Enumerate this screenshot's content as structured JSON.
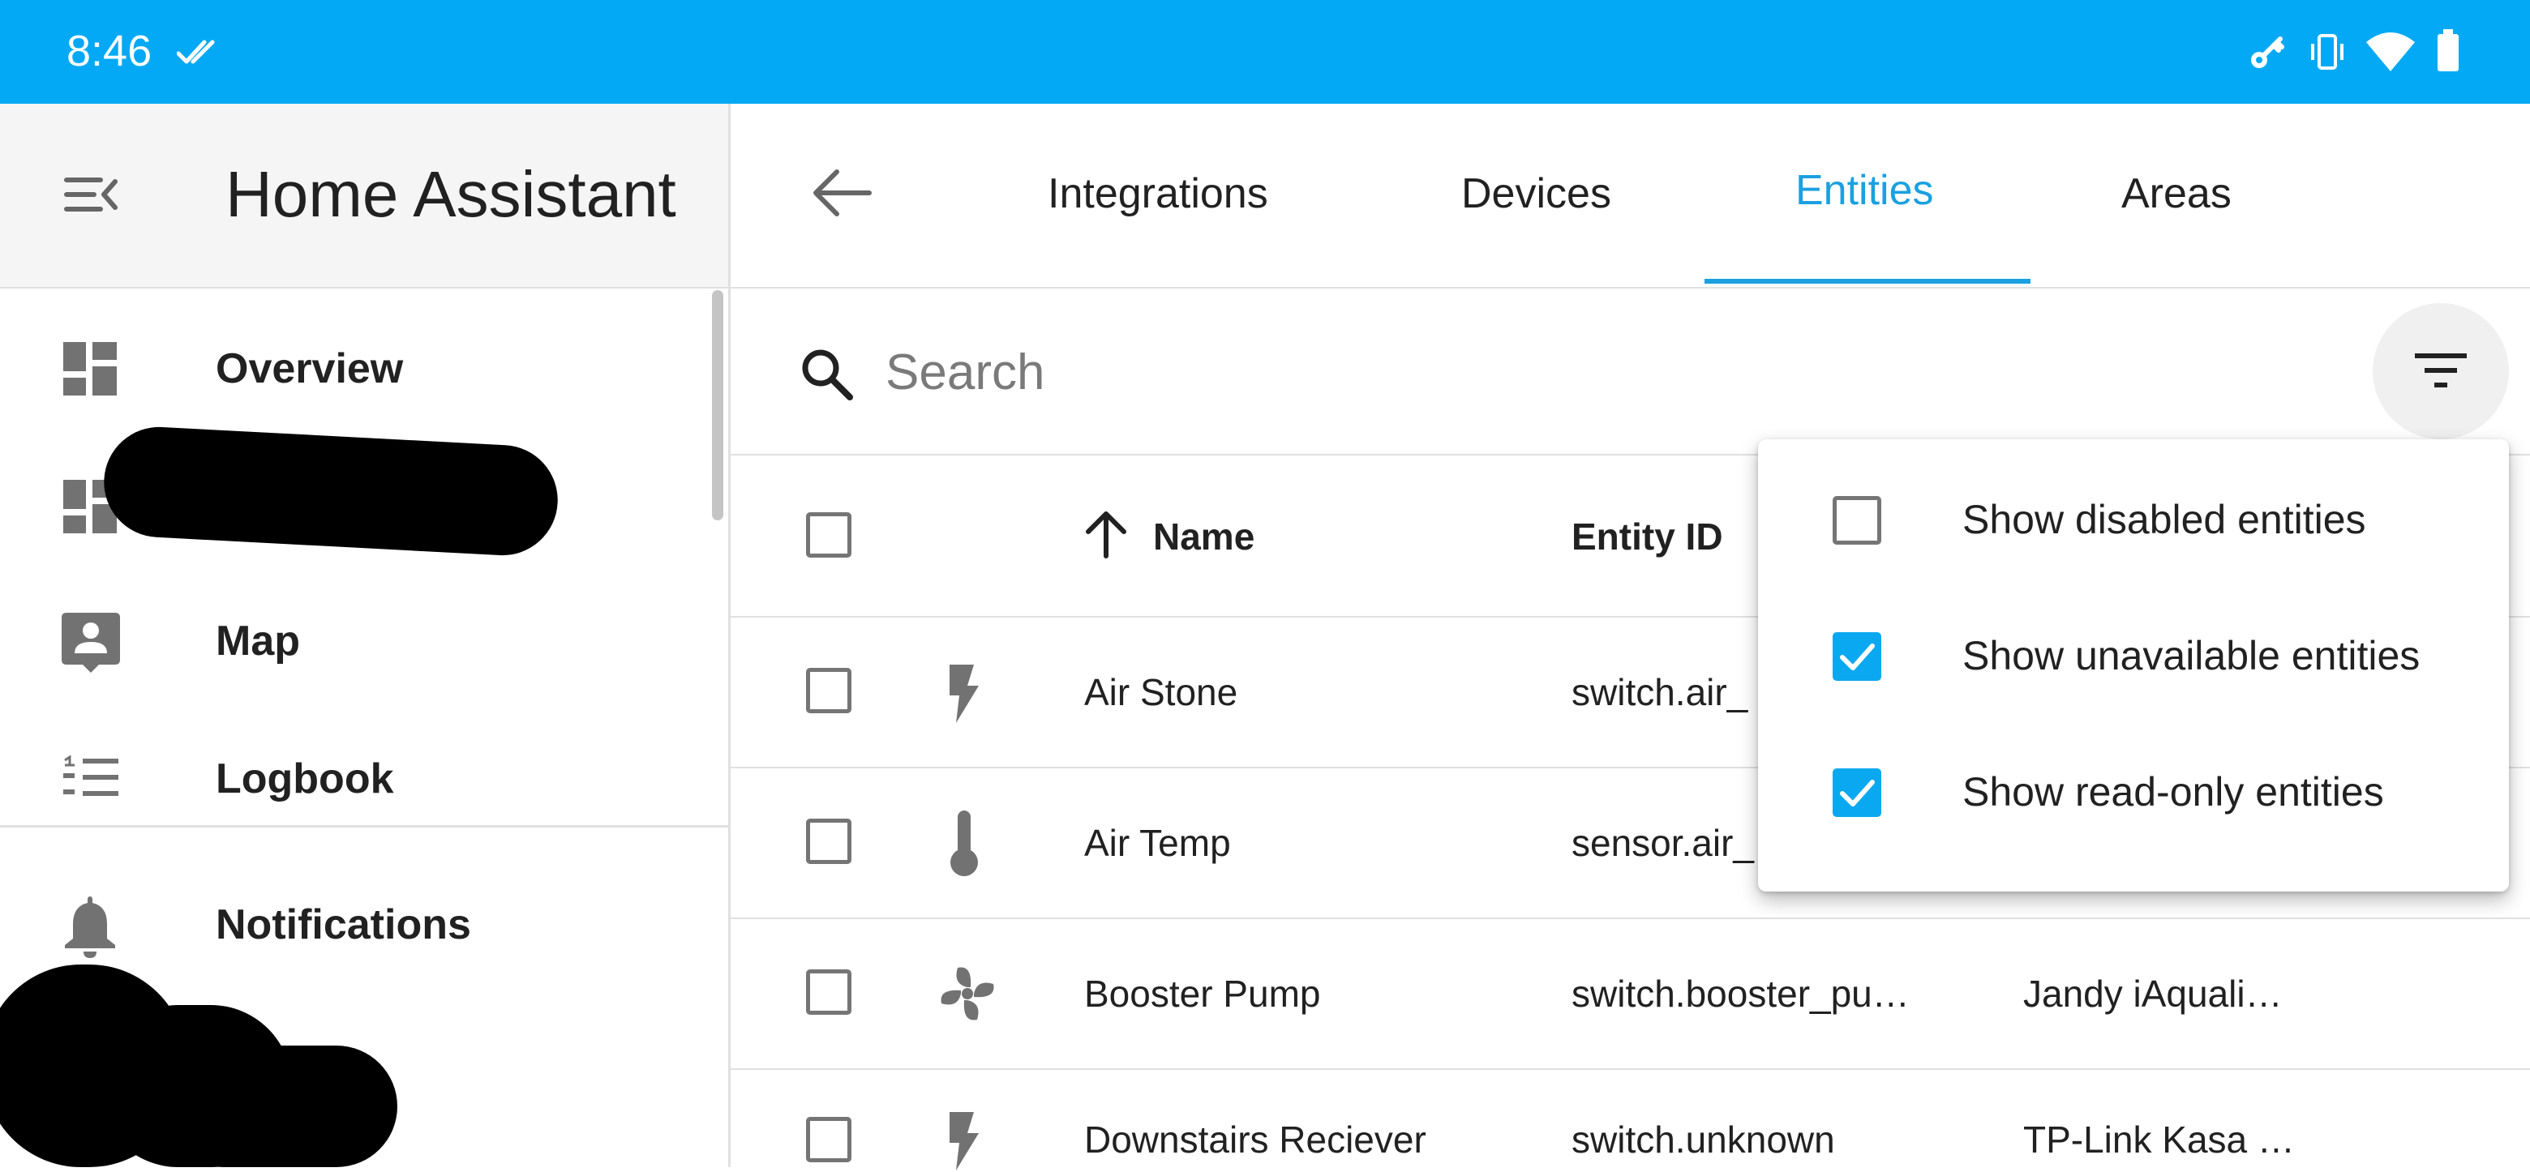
{
  "status_bar": {
    "time": "8:46",
    "icons": [
      "double-check-icon",
      "key-icon",
      "vibrate-icon",
      "wifi-icon",
      "battery-icon"
    ]
  },
  "sidebar": {
    "menu_icon": "menu-collapse-icon",
    "title": "Home Assistant",
    "items": [
      {
        "label": "Overview",
        "icon": "dashboard-icon"
      },
      {
        "label": "",
        "icon": "dashboard-icon"
      },
      {
        "label": "Map",
        "icon": "account-box-icon"
      },
      {
        "label": "Logbook",
        "icon": "list-icon"
      },
      {
        "label": "Notifications",
        "icon": "bell-icon"
      }
    ]
  },
  "tabs": {
    "back_icon": "arrow-left-icon",
    "items": [
      "Integrations",
      "Devices",
      "Entities",
      "Areas"
    ],
    "active": "Entities",
    "accent": "#03a9f4"
  },
  "search": {
    "placeholder": "Search",
    "icon": "search-icon",
    "filter_icon": "filter-icon"
  },
  "table": {
    "columns": {
      "name": "Name",
      "entity_id": "Entity ID"
    },
    "sort_icon": "arrow-up-icon",
    "rows": [
      {
        "name": "Air Stone",
        "entity_id": "switch.air_",
        "integration": "",
        "icon": "flash-icon"
      },
      {
        "name": "Air Temp",
        "entity_id": "sensor.air_",
        "integration": "",
        "icon": "thermometer-icon"
      },
      {
        "name": "Booster Pump",
        "entity_id": "switch.booster_pu…",
        "integration": "Jandy iAquali…",
        "icon": "fan-icon"
      },
      {
        "name": "Downstairs Reciever",
        "entity_id": "switch.unknown",
        "integration": "TP-Link Kasa …",
        "icon": "flash-icon"
      }
    ]
  },
  "filter_menu": {
    "options": [
      {
        "label": "Show disabled entities",
        "checked": false
      },
      {
        "label": "Show unavailable entities",
        "checked": true
      },
      {
        "label": "Show read-only entities",
        "checked": true
      }
    ]
  }
}
